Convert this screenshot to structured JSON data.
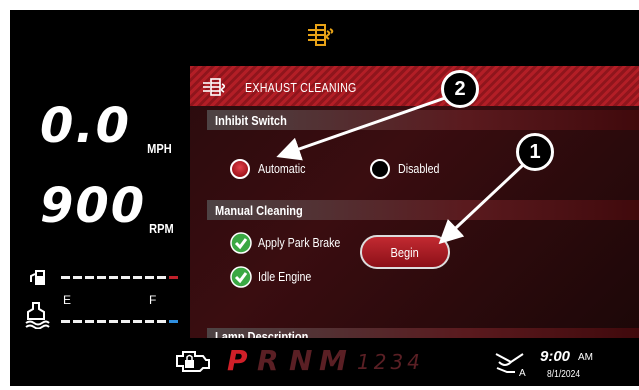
{
  "colors": {
    "accent_red": "#b31e26",
    "indicator_amber": "#e8a317",
    "check_green": "#3aa843",
    "fuel_red": "#c0202a",
    "def_blue": "#2f8fe0"
  },
  "top": {
    "indicator_icon": "exhaust-filter-icon"
  },
  "gauges": {
    "speed_value": "0.0",
    "speed_unit": "MPH",
    "rpm_value": "900",
    "rpm_unit": "RPM",
    "fuel_icon": "fuel-pump-icon",
    "def_icon": "def-fluid-icon",
    "def_empty_label": "E",
    "def_full_label": "F"
  },
  "panel": {
    "title": "EXHAUST CLEANING",
    "icon": "exhaust-filter-icon",
    "inhibit_switch": {
      "label": "Inhibit Switch",
      "options": [
        {
          "label": "Automatic",
          "selected": true
        },
        {
          "label": "Disabled",
          "selected": false
        }
      ]
    },
    "manual_cleaning": {
      "label": "Manual Cleaning",
      "checklist": [
        {
          "label": "Apply Park Brake",
          "checked": true
        },
        {
          "label": "Idle Engine",
          "checked": true
        }
      ],
      "button_label": "Begin"
    },
    "lamp_description": {
      "label": "Lamp Description"
    }
  },
  "bottom": {
    "engine_icon": "engine-lock-icon",
    "gears": [
      "P",
      "R",
      "N",
      "M"
    ],
    "gear_numbers": "1234",
    "auto_icon": "auto-mode-icon",
    "auto_letter": "A",
    "time": "9:00",
    "ampm": "AM",
    "date": "8/1/2024"
  },
  "callouts": [
    "1",
    "2"
  ]
}
